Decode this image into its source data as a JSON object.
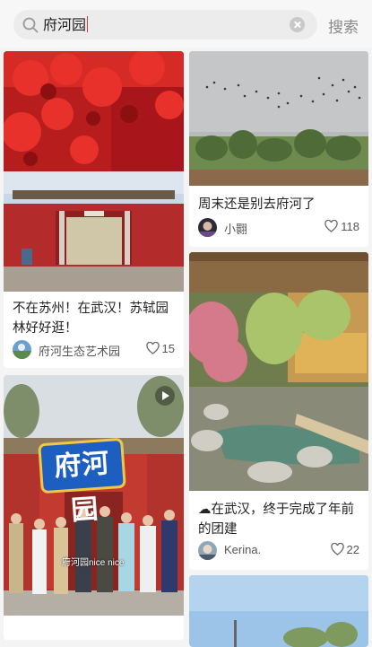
{
  "search": {
    "query": "府河园",
    "cancel_label": "搜索"
  },
  "feed": [
    {
      "title": "不在苏州！在武汉！苏轼园林好好逛！",
      "author": "府河生态艺术园",
      "likes": "15"
    },
    {
      "title": "周末还是别去府河了",
      "author": "小翾",
      "likes": "118"
    },
    {
      "title": "府河园",
      "subtitle": "府河园nice nice",
      "is_video": true
    },
    {
      "title": "☁在武汉，终于完成了年前的团建",
      "author": "Kerina.",
      "likes": "22"
    }
  ],
  "colors": {
    "search_bg": "#ececec",
    "accent_caret": "#e53935",
    "text_primary": "#222222",
    "text_secondary": "#555555"
  }
}
